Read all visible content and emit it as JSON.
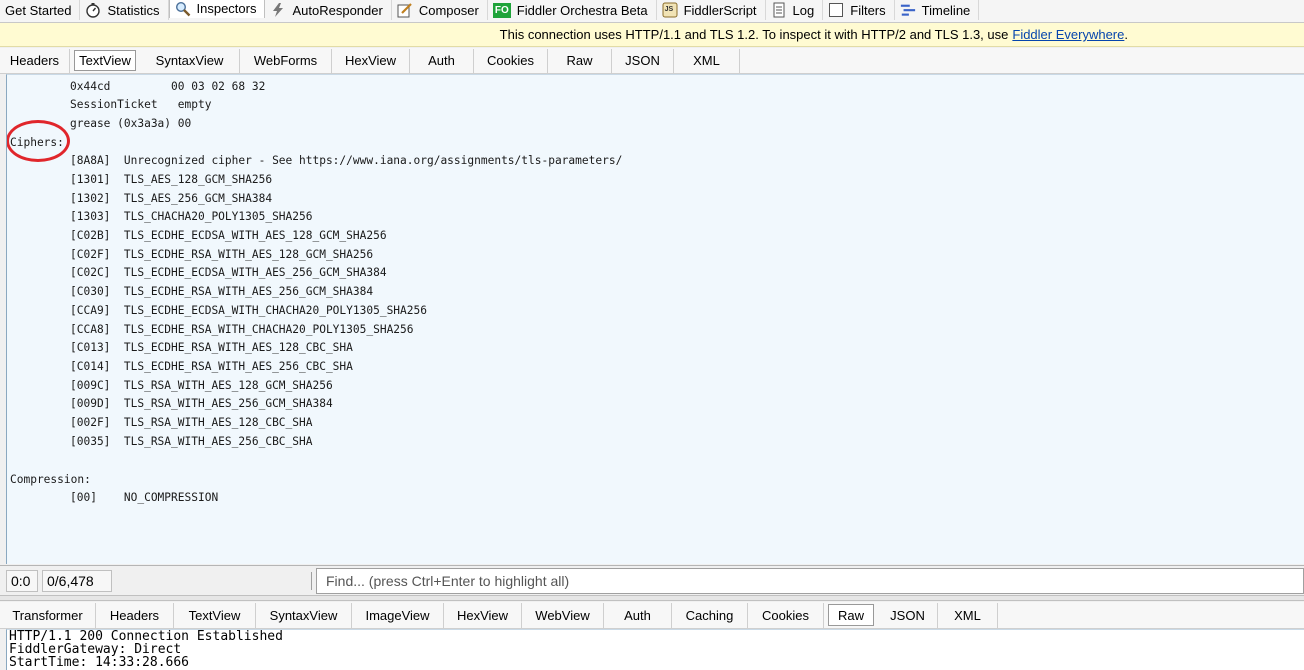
{
  "main_tabs": [
    {
      "label": "Get Started",
      "icon": "none"
    },
    {
      "label": "Statistics",
      "icon": "stopwatch-icon"
    },
    {
      "label": "Inspectors",
      "icon": "magnifier-icon",
      "active": true
    },
    {
      "label": "AutoResponder",
      "icon": "lightning-icon"
    },
    {
      "label": "Composer",
      "icon": "pencil-note-icon"
    },
    {
      "label": "Fiddler Orchestra Beta",
      "icon": "fo-badge-icon",
      "badge": "FO"
    },
    {
      "label": "FiddlerScript",
      "icon": "script-js-icon",
      "badge": "JS"
    },
    {
      "label": "Log",
      "icon": "log-icon"
    },
    {
      "label": "Filters",
      "icon": "checkbox-icon"
    },
    {
      "label": "Timeline",
      "icon": "timeline-icon"
    }
  ],
  "banner": {
    "text": "This connection uses HTTP/1.1 and TLS 1.2. To inspect it with HTTP/2 and TLS 1.3, use",
    "link": "Fiddler Everywhere",
    "suffix": "."
  },
  "request_tabs": [
    "Headers",
    "TextView",
    "SyntaxView",
    "WebForms",
    "HexView",
    "Auth",
    "Cookies",
    "Raw",
    "JSON",
    "XML"
  ],
  "request_active": "TextView",
  "textview_lines": [
    "0x44cd         00 03 02 68 32",
    "SessionTicket   empty",
    "grease (0x3a3a) 00",
    "Ciphers:",
    "[8A8A]  Unrecognized cipher - See https://www.iana.org/assignments/tls-parameters/",
    "[1301]  TLS_AES_128_GCM_SHA256",
    "[1302]  TLS_AES_256_GCM_SHA384",
    "[1303]  TLS_CHACHA20_POLY1305_SHA256",
    "[C02B]  TLS_ECDHE_ECDSA_WITH_AES_128_GCM_SHA256",
    "[C02F]  TLS_ECDHE_RSA_WITH_AES_128_GCM_SHA256",
    "[C02C]  TLS_ECDHE_ECDSA_WITH_AES_256_GCM_SHA384",
    "[C030]  TLS_ECDHE_RSA_WITH_AES_256_GCM_SHA384",
    "[CCA9]  TLS_ECDHE_ECDSA_WITH_CHACHA20_POLY1305_SHA256",
    "[CCA8]  TLS_ECDHE_RSA_WITH_CHACHA20_POLY1305_SHA256",
    "[C013]  TLS_ECDHE_RSA_WITH_AES_128_CBC_SHA",
    "[C014]  TLS_ECDHE_RSA_WITH_AES_256_CBC_SHA",
    "[009C]  TLS_RSA_WITH_AES_128_GCM_SHA256",
    "[009D]  TLS_RSA_WITH_AES_256_GCM_SHA384",
    "[002F]  TLS_RSA_WITH_AES_128_CBC_SHA",
    "[0035]  TLS_RSA_WITH_AES_256_CBC_SHA",
    "Compression:",
    "[00]    NO_COMPRESSION"
  ],
  "status": {
    "position": "0:0",
    "count": "0/6,478",
    "find_placeholder": "Find... (press Ctrl+Enter to highlight all)"
  },
  "response_tabs": [
    "Transformer",
    "Headers",
    "TextView",
    "SyntaxView",
    "ImageView",
    "HexView",
    "WebView",
    "Auth",
    "Caching",
    "Cookies",
    "Raw",
    "JSON",
    "XML"
  ],
  "response_active": "Raw",
  "raw_lines": [
    "HTTP/1.1 200 Connection Established",
    "FiddlerGateway: Direct",
    "StartTime: 14:33:28.666"
  ],
  "colors": {
    "highlight_circle": "#e0262b",
    "textview_bg": "#f1f8fd",
    "banner_bg": "#fffbd2",
    "link": "#0645ad"
  }
}
